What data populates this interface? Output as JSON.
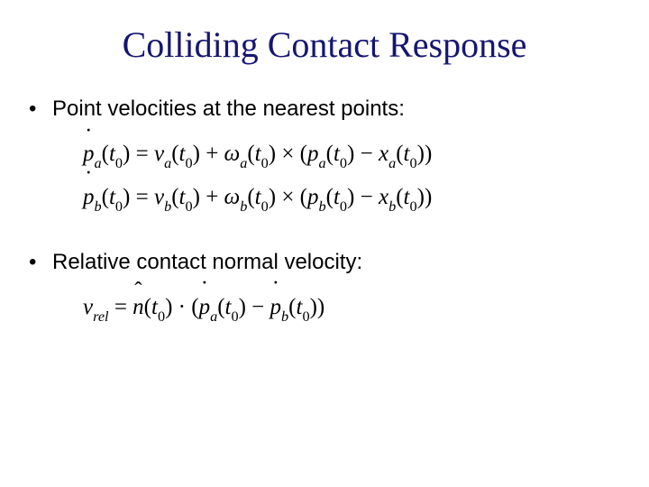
{
  "title": "Colliding Contact Response",
  "bullets": {
    "b1": "Point velocities at the nearest points:",
    "b2": "Relative contact normal velocity:"
  },
  "eq": {
    "pa": {
      "lhs_var": "p",
      "lhs_sub": "a",
      "lhs_arg": "t",
      "lhs_arg_sub": "0",
      "rhs_v": "v",
      "rhs_v_sub": "a",
      "rhs_w": "ω",
      "rhs_w_sub": "a",
      "rhs_p": "p",
      "rhs_p_sub": "a",
      "rhs_x": "x",
      "rhs_x_sub": "a"
    },
    "pb": {
      "lhs_var": "p",
      "lhs_sub": "b",
      "lhs_arg": "t",
      "lhs_arg_sub": "0",
      "rhs_v": "v",
      "rhs_v_sub": "b",
      "rhs_w": "ω",
      "rhs_w_sub": "b",
      "rhs_p": "p",
      "rhs_p_sub": "b",
      "rhs_x": "x",
      "rhs_x_sub": "b"
    },
    "vrel": {
      "lhs_var": "v",
      "lhs_sub": "rel",
      "n_var": "n",
      "t_var": "t",
      "t_sub": "0",
      "pa_var": "p",
      "pa_sub": "a",
      "pb_var": "p",
      "pb_sub": "b"
    }
  },
  "sym": {
    "eq": "=",
    "plus": "+",
    "minus": "−",
    "cross": "×",
    "dot": "·",
    "lp": "(",
    "rp": ")"
  }
}
